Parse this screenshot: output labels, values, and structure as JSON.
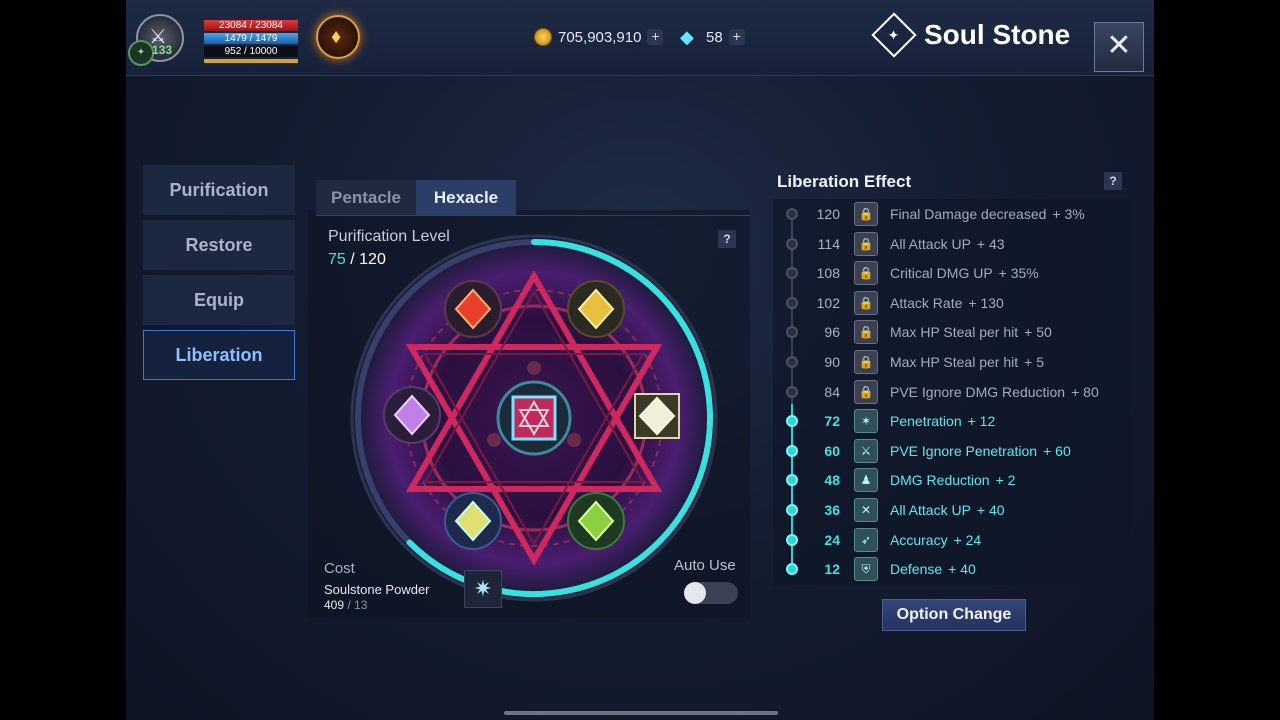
{
  "player": {
    "level": "133",
    "hp": "23084 / 23084",
    "mp": "1479 / 1479",
    "xp": "952 / 10000"
  },
  "currency": {
    "gold": "705,903,910",
    "gems": "58"
  },
  "header": {
    "title": "Soul Stone",
    "close_label": "✕"
  },
  "menu": {
    "items": [
      {
        "label": "Purification"
      },
      {
        "label": "Restore"
      },
      {
        "label": "Equip"
      },
      {
        "label": "Liberation"
      }
    ],
    "active": "Liberation"
  },
  "tabs": [
    {
      "label": "Pentacle"
    },
    {
      "label": "Hexacle"
    }
  ],
  "purification": {
    "label": "Purification Level",
    "current": "75",
    "max": "120",
    "progress_fraction": 0.625
  },
  "cost": {
    "label": "Cost",
    "item": "Soulstone Powder",
    "owned": "409",
    "required": "13"
  },
  "auto_use": {
    "label": "Auto Use",
    "enabled": false
  },
  "liberation": {
    "title": "Liberation Effect",
    "help": "?",
    "effects": [
      {
        "level": "120",
        "name": "Final Damage decreased",
        "bonus": "+ 3%",
        "unlocked": false,
        "icon": "lock-icon"
      },
      {
        "level": "114",
        "name": "All Attack UP",
        "bonus": "+ 43",
        "unlocked": false,
        "icon": "lock-icon"
      },
      {
        "level": "108",
        "name": "Critical DMG UP",
        "bonus": "+ 35%",
        "unlocked": false,
        "icon": "lock-icon"
      },
      {
        "level": "102",
        "name": "Attack Rate",
        "bonus": "+ 130",
        "unlocked": false,
        "icon": "lock-icon"
      },
      {
        "level": "96",
        "name": "Max HP Steal per hit",
        "bonus": "+ 50",
        "unlocked": false,
        "icon": "lock-icon"
      },
      {
        "level": "90",
        "name": "Max HP Steal per hit",
        "bonus": "+ 5",
        "unlocked": false,
        "icon": "lock-icon"
      },
      {
        "level": "84",
        "name": "PVE Ignore DMG Reduction",
        "bonus": "+ 80",
        "unlocked": false,
        "icon": "lock-icon"
      },
      {
        "level": "72",
        "name": "Penetration",
        "bonus": "+ 12",
        "unlocked": true,
        "icon": "penetration-icon"
      },
      {
        "level": "60",
        "name": "PVE Ignore Penetration",
        "bonus": "+ 60",
        "unlocked": true,
        "icon": "pve-icon"
      },
      {
        "level": "48",
        "name": "DMG Reduction",
        "bonus": "+ 2",
        "unlocked": true,
        "icon": "dmg-reduction-icon"
      },
      {
        "level": "36",
        "name": "All Attack UP",
        "bonus": "+ 40",
        "unlocked": true,
        "icon": "attack-icon"
      },
      {
        "level": "24",
        "name": "Accuracy",
        "bonus": "+ 24",
        "unlocked": true,
        "icon": "accuracy-icon"
      },
      {
        "level": "12",
        "name": "Defense",
        "bonus": "+ 40",
        "unlocked": true,
        "icon": "defense-icon"
      }
    ],
    "option_button": "Option Change"
  },
  "gems": [
    {
      "name": "red-gem",
      "color": "#e8402c"
    },
    {
      "name": "gold-gem",
      "color": "#e8c040"
    },
    {
      "name": "purple-gem",
      "color": "#c080e8"
    },
    {
      "name": "center-red-gem",
      "color": "#e83060"
    },
    {
      "name": "white-gem",
      "color": "#f0f0d8"
    },
    {
      "name": "blue-gem",
      "color": "#e0e070"
    },
    {
      "name": "green-gem",
      "color": "#8ad040"
    }
  ]
}
